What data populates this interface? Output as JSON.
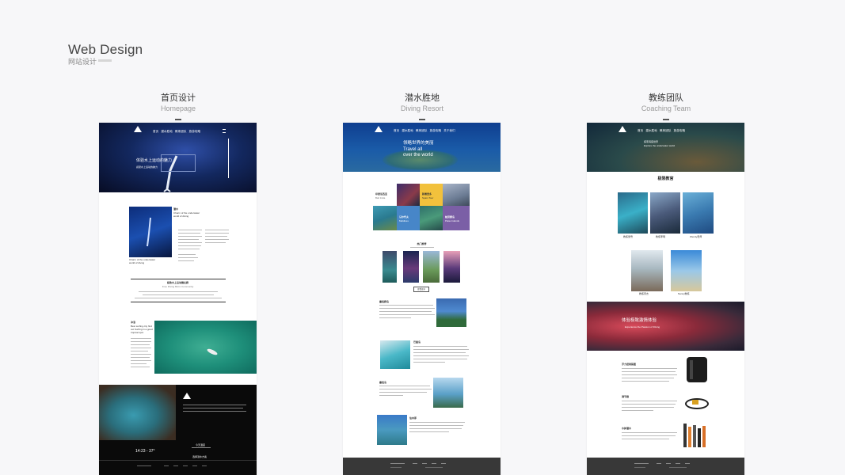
{
  "header": {
    "title": "Web Design",
    "subtitle": "网站设计"
  },
  "columns": [
    {
      "zh": "首页设计",
      "en": "Homepage"
    },
    {
      "zh": "潜水胜地",
      "en": "Diving Resort"
    },
    {
      "zh": "教练团队",
      "en": "Coaching Team"
    }
  ],
  "homepage": {
    "hero_text": "体验水上运动的魅力",
    "hero_sub": "感受水上运动的魅力",
    "article_title": "Charm of the underwater world of diving",
    "article_label": "潜水",
    "caption": "Charm of the underwater world of diving",
    "section_title": "极致水上运动微社群",
    "section_sub": "Free Diving Micro Community",
    "time": "14:23 - 37°",
    "weather": "今天温度",
    "cta": "选择潜水方案",
    "section2_title": "冲浪",
    "section2_sub": "Best surfing city find out Surfing in a good tropical spot"
  },
  "resort": {
    "hero_title": "领略世界的美丽",
    "hero_en1": "Travel all",
    "hero_en2": "over the world",
    "tile1": "印度尼西亚",
    "tile1_en": "Bali India",
    "tile2": "新喀里多",
    "tile2_en": "Spain Tour",
    "tile3": "马尔代夫",
    "tile3_en": "Maldives",
    "tile4": "帕劳群岛",
    "tile4_en": "Palau Islands",
    "more_title": "热门推荐",
    "more_btn": "查看更多",
    "place1": "塞班群岛",
    "place2": "巴厘岛",
    "place3": "塞班岛",
    "place4": "仙本那"
  },
  "team": {
    "hero_title": "探索海底世界",
    "hero_sub": "Explore the underwater world",
    "section_title": "极限教官",
    "banner_title": "体验极致激情体验",
    "banner_sub": "Experience the Passion of Diving",
    "coach1": "教练吴雪",
    "coach2": "教练李明",
    "coach3": "Wendy老师",
    "coach4": "教练周杰",
    "coach5": "Nancy教练",
    "gear1": "浮力控制装置",
    "gear2": "调节器",
    "gear3": "水肺潜水"
  },
  "nav": {
    "items": [
      "首页",
      "潜水胜地",
      "教练团队",
      "旅游攻略",
      "关于我们"
    ]
  }
}
